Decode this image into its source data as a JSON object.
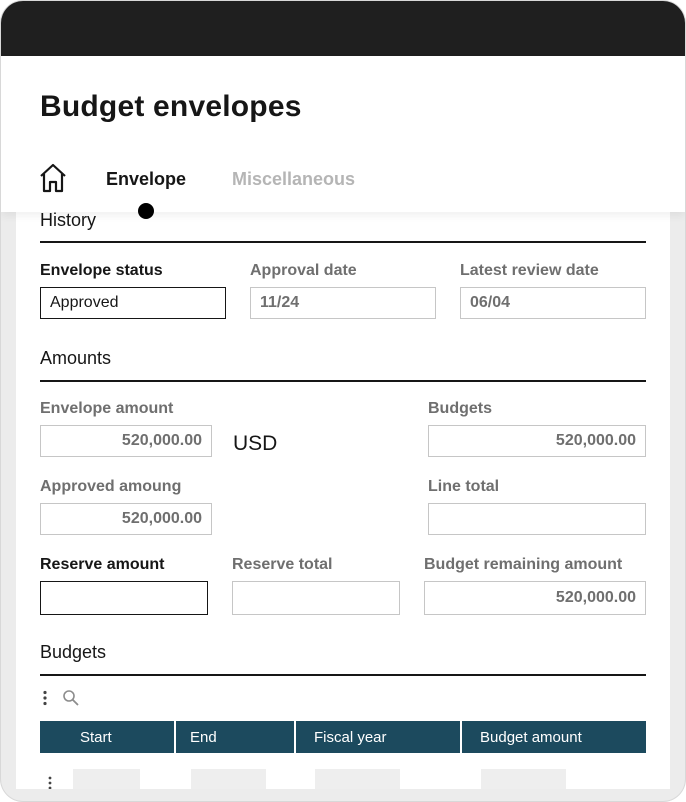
{
  "header": {
    "title": "Budget envelopes",
    "tabs": [
      {
        "label": "Envelope",
        "active": true
      },
      {
        "label": "Miscellaneous",
        "active": false
      }
    ]
  },
  "history": {
    "section_title": "History",
    "envelope_status": {
      "label": "Envelope status",
      "value": "Approved"
    },
    "approval_date": {
      "label": "Approval date",
      "value": "11/24"
    },
    "latest_review_date": {
      "label": "Latest review date",
      "value": "06/04"
    }
  },
  "amounts": {
    "section_title": "Amounts",
    "envelope_amount": {
      "label": "Envelope amount",
      "value": "520,000.00"
    },
    "currency": "USD",
    "budgets": {
      "label": "Budgets",
      "value": "520,000.00"
    },
    "approved_amount": {
      "label": "Approved amoung",
      "value": "520,000.00"
    },
    "line_total": {
      "label": "Line total",
      "value": ""
    },
    "reserve_amount": {
      "label": "Reserve amount",
      "value": ""
    },
    "reserve_total": {
      "label": "Reserve total",
      "value": ""
    },
    "budget_remaining": {
      "label": "Budget remaining amount",
      "value": "520,000.00"
    }
  },
  "budgets_table": {
    "section_title": "Budgets",
    "columns": [
      "Start",
      "End",
      "Fiscal year",
      "Budget amount"
    ]
  },
  "colors": {
    "table_header": "#1c4a5e",
    "status_bar": "#1f1f1f"
  }
}
